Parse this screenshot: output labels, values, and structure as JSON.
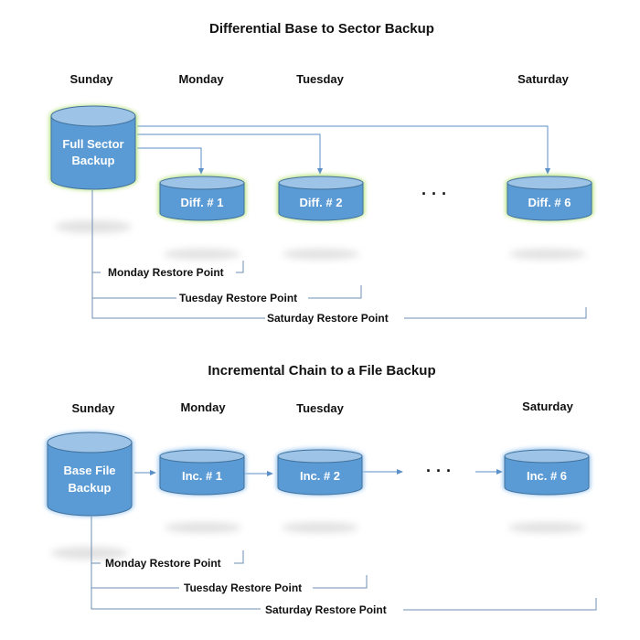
{
  "diagrams": [
    {
      "title": "Differential Base to Sector Backup",
      "days": [
        "Sunday",
        "Monday",
        "Tuesday",
        "Saturday"
      ],
      "base": {
        "line1": "Full Sector",
        "line2": "Backup"
      },
      "nodes": [
        "Diff. # 1",
        "Diff. # 2",
        "Diff. # 6"
      ],
      "ellipsis": "· · ·",
      "restore_points": [
        "Monday Restore Point",
        "Tuesday Restore Point",
        "Saturday Restore Point"
      ],
      "glow_color": "#b6e27a"
    },
    {
      "title": "Incremental Chain to a File Backup",
      "days": [
        "Sunday",
        "Monday",
        "Tuesday",
        "Saturday"
      ],
      "base": {
        "line1": "Base File",
        "line2": "Backup"
      },
      "nodes": [
        "Inc. # 1",
        "Inc. # 2",
        "Inc. # 6"
      ],
      "ellipsis": "· · ·",
      "restore_points": [
        "Monday Restore Point",
        "Tuesday Restore Point",
        "Saturday Restore Point"
      ],
      "glow_color": "#9cc8f0"
    }
  ],
  "colors": {
    "cylinder_body": "#5b9bd5",
    "cylinder_top": "#9dc3e6",
    "cylinder_edge": "#41719c",
    "connector": "#5b8fc7"
  }
}
